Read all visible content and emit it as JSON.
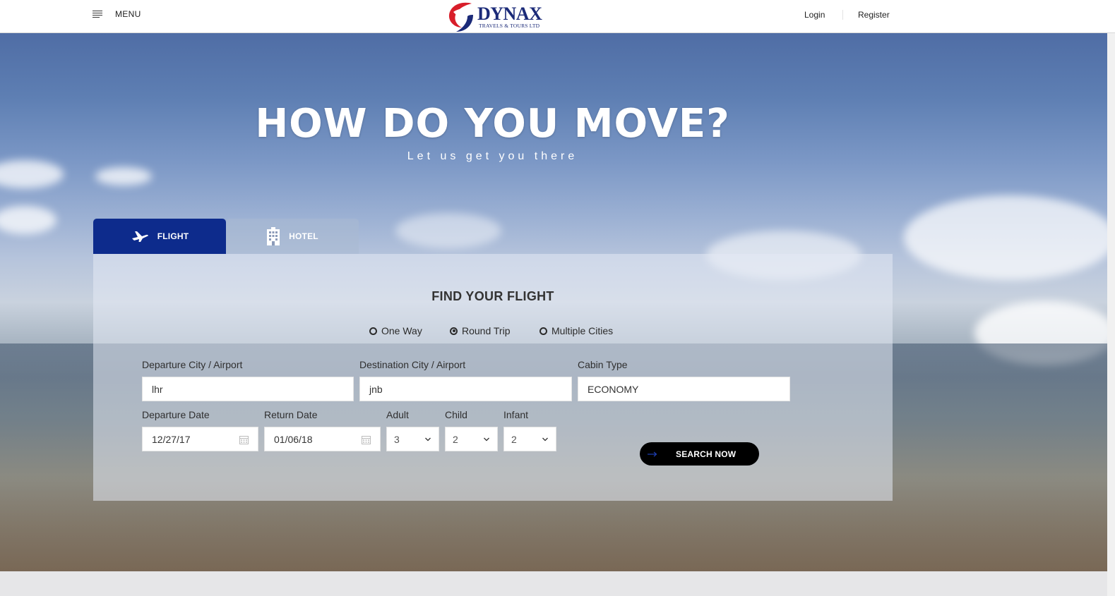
{
  "header": {
    "menu_label": "MENU",
    "logo_name": "DYNAX",
    "logo_sub": "TRAVELS & TOURS LTD",
    "login_label": "Login",
    "register_label": "Register"
  },
  "hero": {
    "title": "HOW DO YOU MOVE?",
    "subtitle": "Let us get you there"
  },
  "tabs": [
    {
      "label": "FLIGHT",
      "icon": "airplane-icon",
      "active": true
    },
    {
      "label": "HOTEL",
      "icon": "hotel-building-icon",
      "active": false
    }
  ],
  "form": {
    "title": "FIND YOUR FLIGHT",
    "trip_types": [
      {
        "label": "One Way",
        "selected": false
      },
      {
        "label": "Round Trip",
        "selected": true
      },
      {
        "label": "Multiple Cities",
        "selected": false
      }
    ],
    "departure_label": "Departure City / Airport",
    "departure_value": "lhr",
    "destination_label": "Destination City / Airport",
    "destination_value": "jnb",
    "cabin_label": "Cabin Type",
    "cabin_value": "ECONOMY",
    "departure_date_label": "Departure Date",
    "departure_date_value": "12/27/17",
    "return_date_label": "Return Date",
    "return_date_value": "01/06/18",
    "adult_label": "Adult",
    "adult_value": "3",
    "child_label": "Child",
    "child_value": "2",
    "infant_label": "Infant",
    "infant_value": "2",
    "search_label": "SEARCH NOW"
  },
  "colors": {
    "brand_blue": "#0d2b8c",
    "logo_red": "#d81e2a",
    "button_black": "#000000"
  }
}
